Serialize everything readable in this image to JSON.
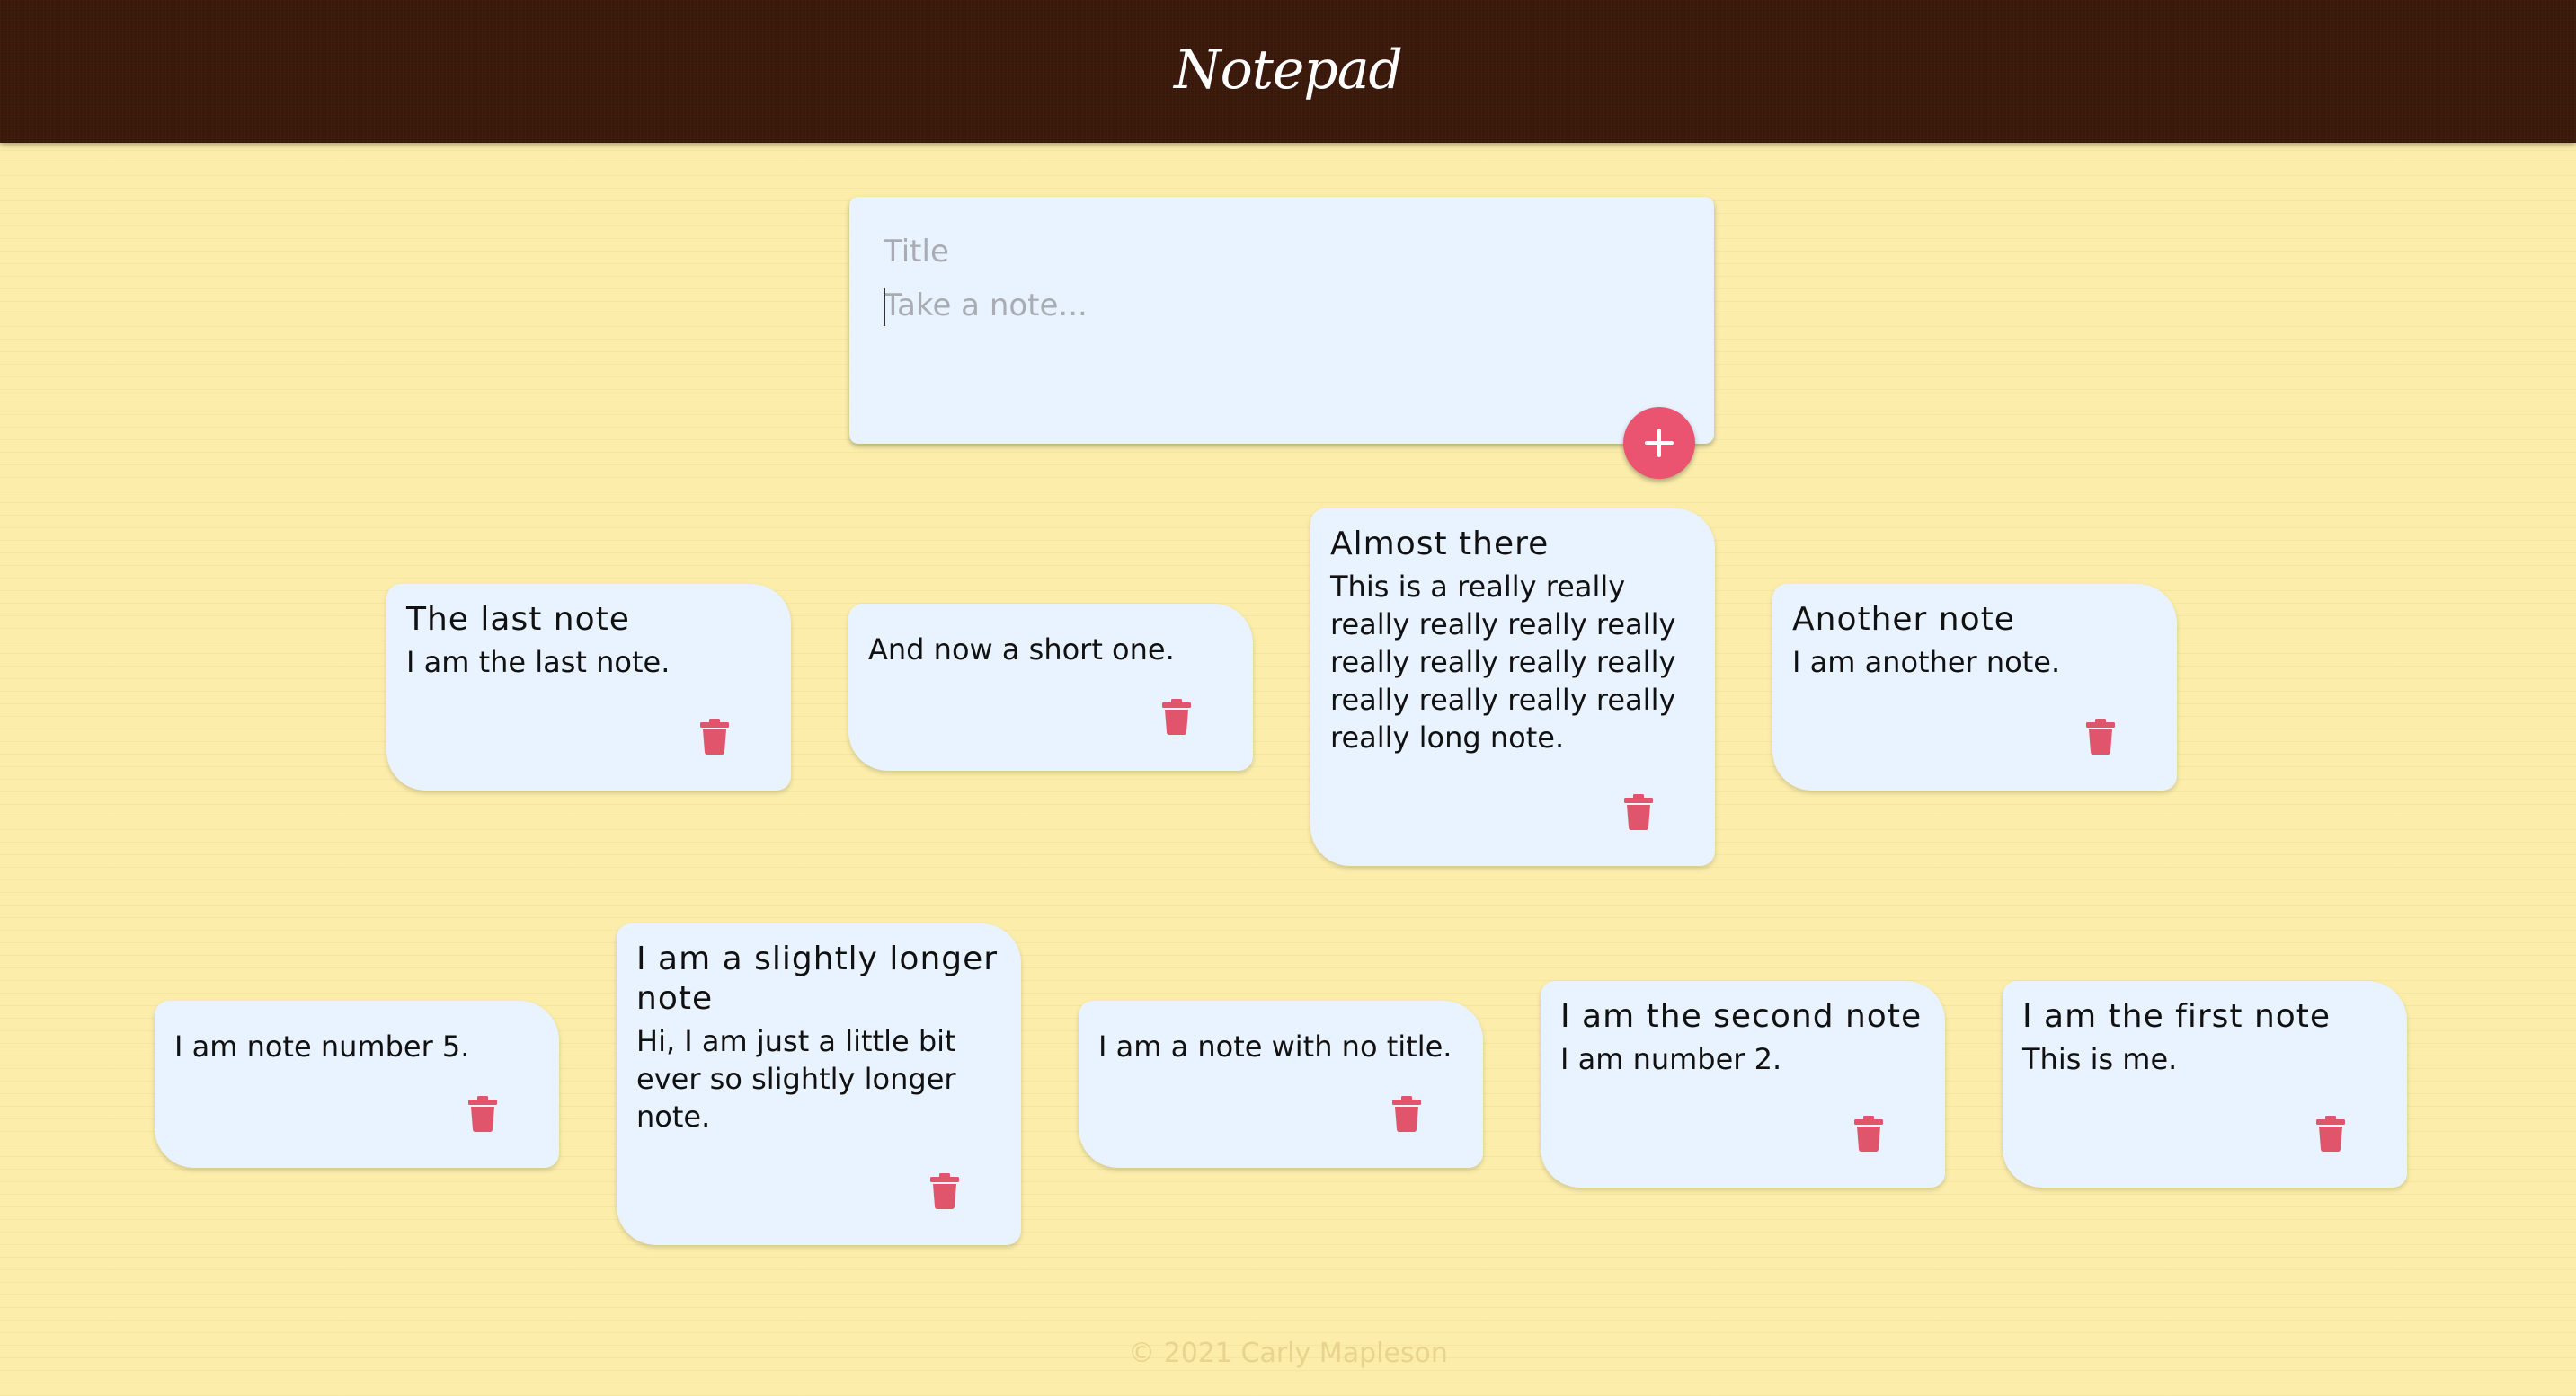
{
  "header": {
    "title": "Notepad"
  },
  "composer": {
    "title_placeholder": "Title",
    "content_placeholder": "Take a note...",
    "add_icon": "plus-icon"
  },
  "notes": [
    {
      "title": "The last note",
      "content": "I am the last note."
    },
    {
      "title": "",
      "content": "And now a short one."
    },
    {
      "title": "Almost there",
      "content": "This is a really really really really really really really really really really really really really really really long note."
    },
    {
      "title": "Another note",
      "content": "I am another note."
    },
    {
      "title": "",
      "content": "I am note number 5."
    },
    {
      "title": "I am a slightly longer note",
      "content": "Hi, I am just a little bit ever so slightly longer note."
    },
    {
      "title": "",
      "content": "I am a note with no title."
    },
    {
      "title": "I am the second note",
      "content": "I am number 2."
    },
    {
      "title": "I am the first note",
      "content": "This is me."
    }
  ],
  "delete_icon": "trash-icon",
  "footer": {
    "copyright": "© 2021 Carly Mapleson"
  },
  "colors": {
    "header_bg": "#3b190b",
    "page_bg": "#fceeaa",
    "note_bg": "#e9f3ff",
    "accent": "#ea5470"
  }
}
